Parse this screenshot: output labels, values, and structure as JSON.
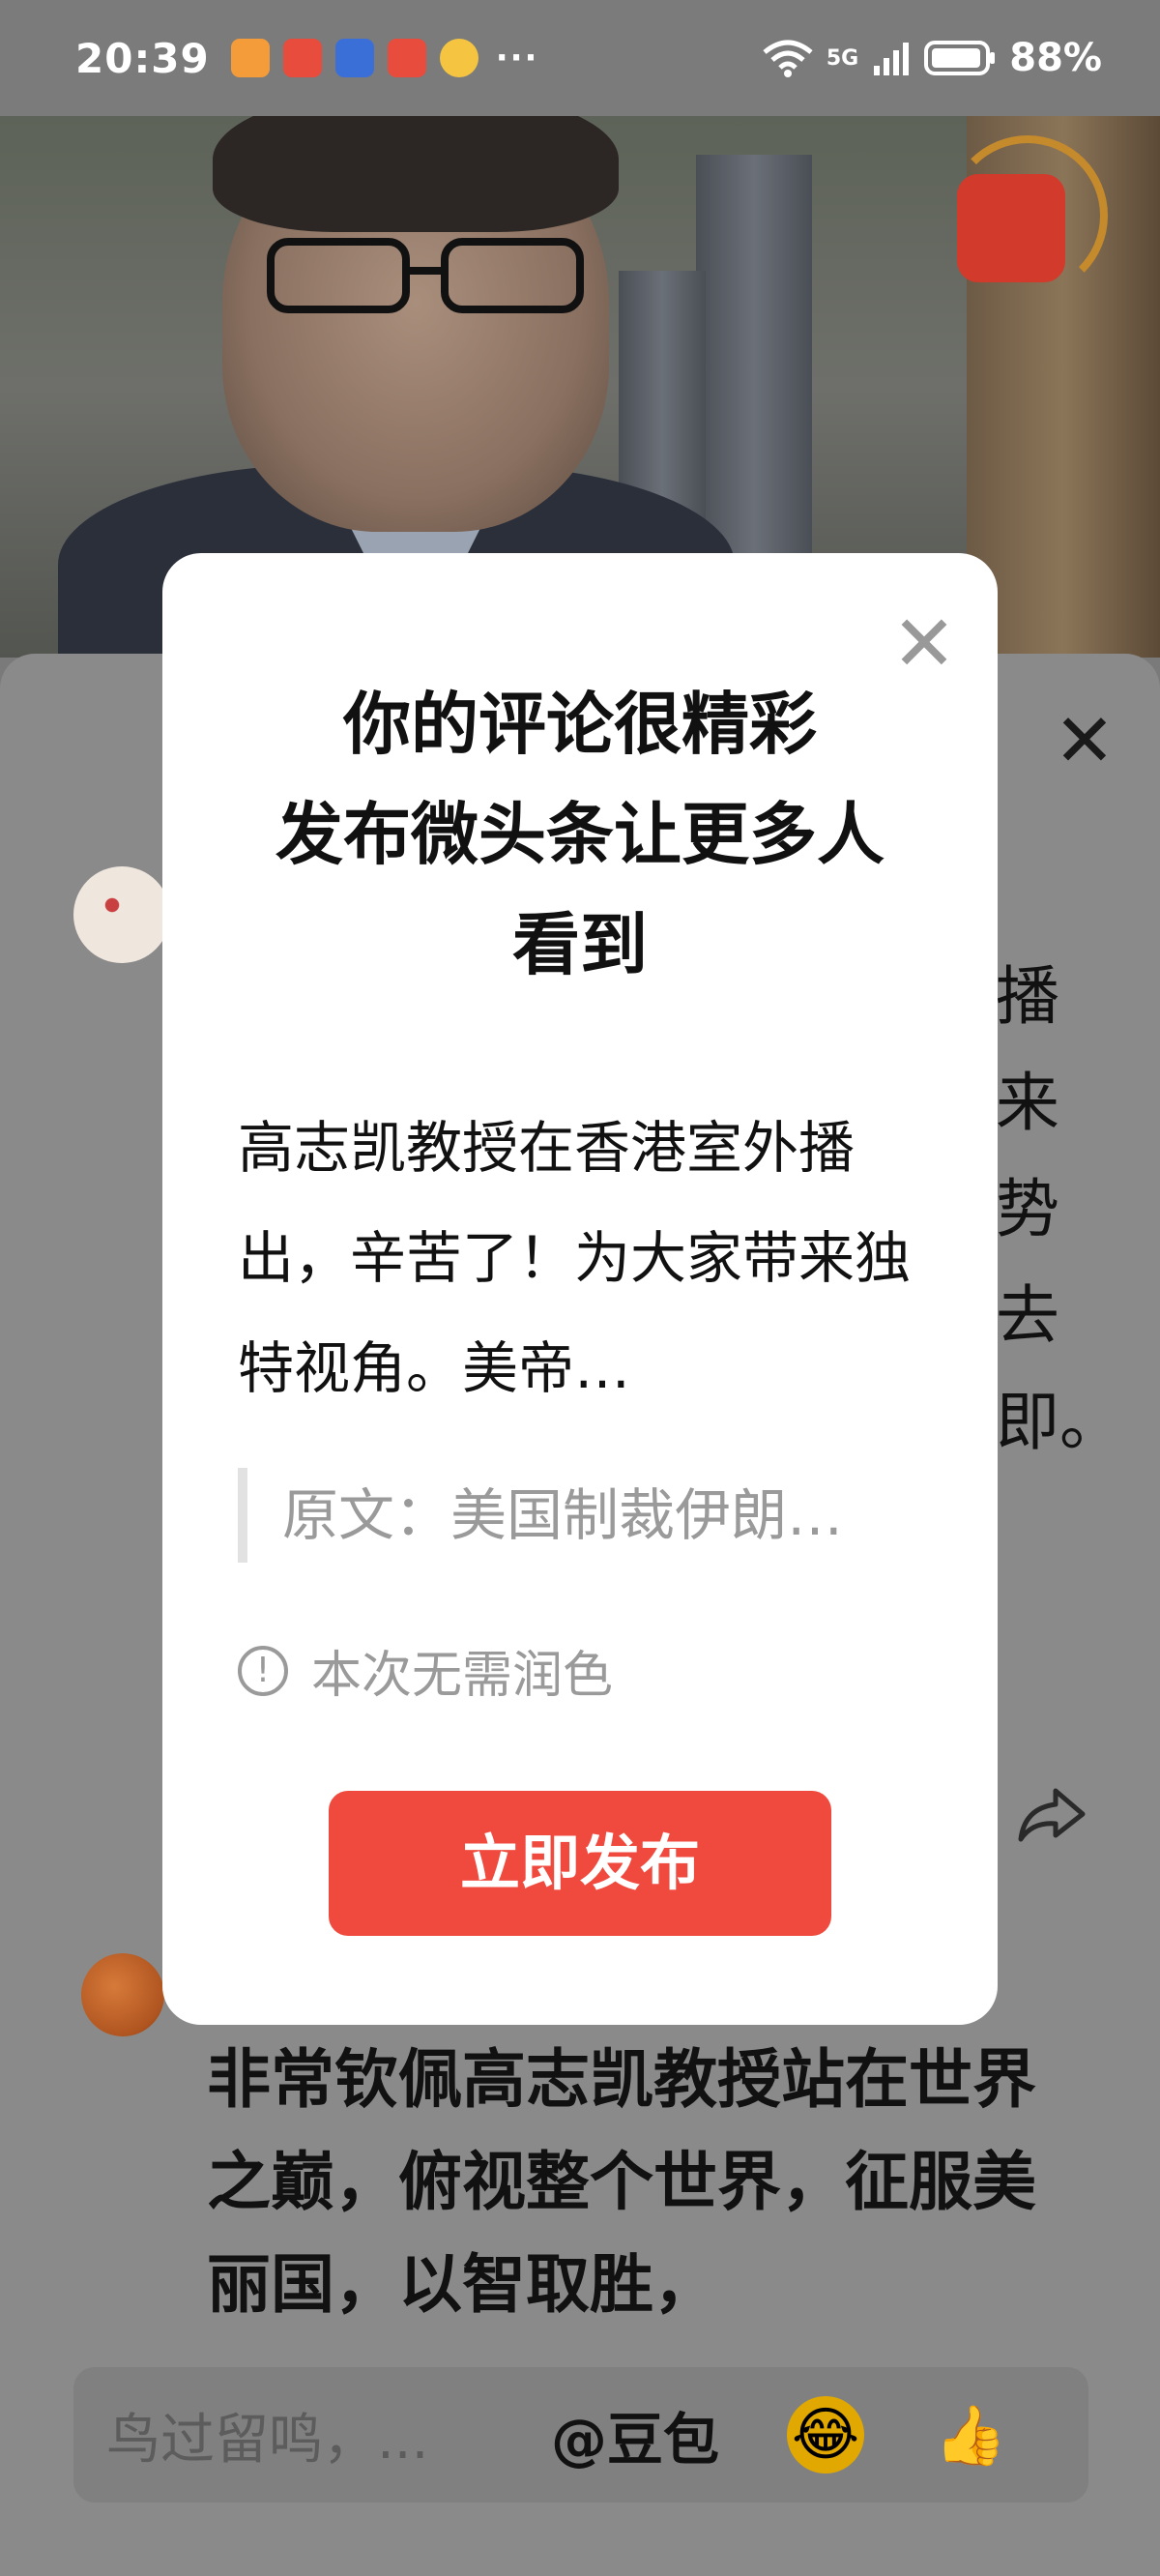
{
  "status_bar": {
    "time": "20:39",
    "network": "5G",
    "battery": "88%",
    "more": "···",
    "app_icons": [
      "health-app-icon",
      "clown-app-icon",
      "shield-app-icon",
      "clown-app-icon",
      "weather-app-icon"
    ]
  },
  "modal": {
    "title_line1": "你的评论很精彩",
    "title_line2": "发布微头条让更多人",
    "title_line3": "看到",
    "body": "高志凯教授在香港室外播出，辛苦了！为大家带来独特视角。美帝…",
    "quote": "原文：美国制裁伊朗…",
    "note": "本次无需润色",
    "publish_button": "立即发布"
  },
  "background_comment1": {
    "right_chars": [
      "播",
      "来",
      "势",
      "去",
      "即。"
    ]
  },
  "background_comment2": {
    "text": "非常钦佩高志凯教授站在世界之巅，俯视整个世界，征服美丽国，以智取胜，"
  },
  "input_bar": {
    "placeholder": "鸟过留鸣，...",
    "mention": "@豆包"
  },
  "colors": {
    "accent": "#f04a3e",
    "overlay": "#7a7a7a",
    "modal_bg": "#ffffff"
  }
}
